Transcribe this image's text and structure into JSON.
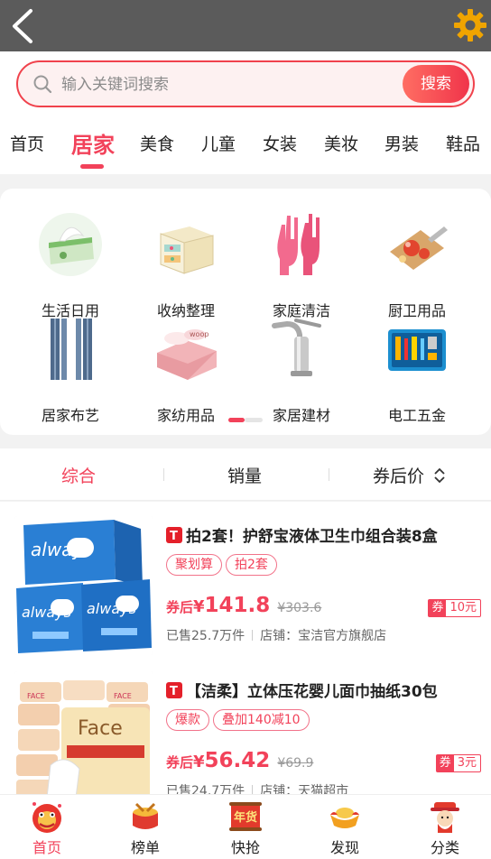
{
  "header": {
    "back_icon": "back-arrow-icon",
    "settings_icon": "gear-icon",
    "accent": "#f2425a"
  },
  "search": {
    "placeholder": "输入关键词搜索",
    "button_label": "搜索"
  },
  "tabs": [
    {
      "label": "首页"
    },
    {
      "label": "居家",
      "active": true
    },
    {
      "label": "美食"
    },
    {
      "label": "儿童"
    },
    {
      "label": "女装"
    },
    {
      "label": "美妆"
    },
    {
      "label": "男装"
    },
    {
      "label": "鞋品"
    }
  ],
  "categories": [
    {
      "label": "生活日用",
      "icon": "tissue-box-icon"
    },
    {
      "label": "收纳整理",
      "icon": "storage-drawer-icon"
    },
    {
      "label": "家庭清洁",
      "icon": "rubber-gloves-icon"
    },
    {
      "label": "厨卫用品",
      "icon": "cutting-board-icon"
    },
    {
      "label": "居家布艺",
      "icon": "curtain-icon"
    },
    {
      "label": "家纺用品",
      "icon": "bedding-icon"
    },
    {
      "label": "家居建材",
      "icon": "faucet-icon"
    },
    {
      "label": "电工五金",
      "icon": "toolbox-icon"
    }
  ],
  "sort": {
    "comprehensive": "综合",
    "sales": "销量",
    "price_after_coupon": "券后价"
  },
  "products": [
    {
      "title": "拍2套！护舒宝液体卫生巾组合装8盒",
      "tags": [
        "聚划算",
        "拍2套"
      ],
      "price_prefix": "券后",
      "currency": "¥",
      "price": "141.8",
      "original_price": "¥303.6",
      "coupon_label": "券",
      "coupon_value": "10元",
      "sold": "已售25.7万件",
      "shop": "店铺：宝洁官方旗舰店"
    },
    {
      "title": "【洁柔】立体压花婴儿面巾抽纸30包",
      "tags": [
        "爆款",
        "叠加140减10"
      ],
      "price_prefix": "券后",
      "currency": "¥",
      "price": "56.42",
      "original_price": "¥69.9",
      "coupon_label": "券",
      "coupon_value": "3元",
      "sold": "已售24.7万件",
      "shop": "店铺：天猫超市"
    }
  ],
  "bottom_nav": [
    {
      "label": "首页",
      "icon": "lion-dance-icon",
      "active": true
    },
    {
      "label": "榜单",
      "icon": "drum-icon"
    },
    {
      "label": "快抢",
      "icon": "new-year-goods-icon",
      "badge": "年货"
    },
    {
      "label": "发现",
      "icon": "gold-ingot-icon"
    },
    {
      "label": "分类",
      "icon": "god-of-wealth-icon"
    }
  ]
}
